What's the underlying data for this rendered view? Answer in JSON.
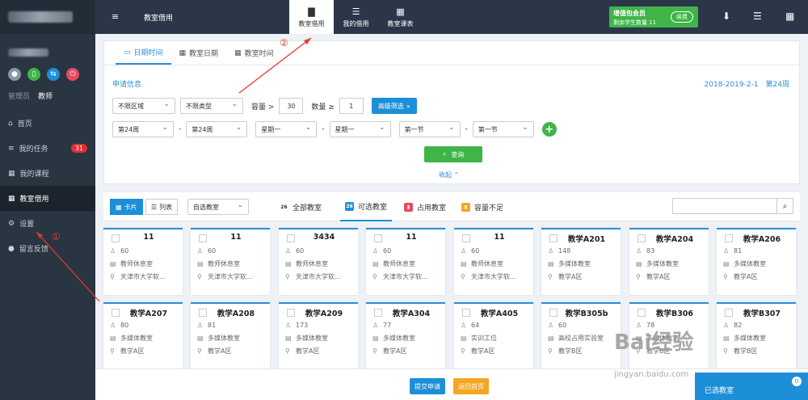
{
  "sidebar": {
    "roles": [
      "管理员",
      "教师"
    ],
    "items": [
      {
        "label": "首页",
        "icon": "home-icon",
        "glyph": "⌂"
      },
      {
        "label": "我的任务",
        "icon": "tasks-icon",
        "glyph": "≡",
        "badge": "31"
      },
      {
        "label": "我的课程",
        "icon": "calendar-icon",
        "glyph": "▦"
      },
      {
        "label": "教室借用",
        "icon": "grid-icon",
        "glyph": "▦",
        "active": true
      },
      {
        "label": "设置",
        "icon": "gear-icon",
        "glyph": "⚙"
      },
      {
        "label": "留言反馈",
        "icon": "chat-icon",
        "glyph": "●"
      }
    ]
  },
  "topbar": {
    "menu_glyph": "≡",
    "title": "教室借用",
    "tabs": [
      {
        "label": "教室借用",
        "icon": "document-icon",
        "glyph": "▇"
      },
      {
        "label": "我的借用",
        "icon": "list-icon",
        "glyph": "☰"
      },
      {
        "label": "教室课表",
        "icon": "calendar-icon",
        "glyph": "▦"
      }
    ],
    "vip_title": "增值包会员",
    "vip_sub": "剩余学生数量 11",
    "renew": "续费",
    "right_icons": [
      {
        "name": "download-icon",
        "glyph": "⬇"
      },
      {
        "name": "server-icon",
        "glyph": "☰"
      },
      {
        "name": "apps-icon",
        "glyph": "▦"
      }
    ]
  },
  "panel": {
    "tabs": [
      {
        "label": "日期时间",
        "icon": "calendar-icon",
        "glyph": "▭"
      },
      {
        "label": "教室日期",
        "icon": "calendar-icon",
        "glyph": "▦"
      },
      {
        "label": "教室时间",
        "icon": "table-icon",
        "glyph": "▦"
      }
    ],
    "section_title": "申请信息",
    "date_info": "2018-2019-2-1　第24周",
    "area": "不限区域",
    "type": "不限类型",
    "capacity_label": "容量 >",
    "capacity_value": "30",
    "qty_label": "数量 ≥",
    "qty_value": "1",
    "advanced": "高级筛选",
    "week_from": "第24周",
    "week_to": "第24周",
    "day_from": "星期一",
    "day_to": "星期一",
    "sec_from": "第一节",
    "sec_to": "第一节",
    "query": "查询",
    "collapse": "收起"
  },
  "filterbar": {
    "view_card": "卡片",
    "view_list": "列表",
    "self_select": "自选教室",
    "tabs": [
      {
        "label": "全部教室",
        "icon_text": "26",
        "color": "#fff",
        "text_color": "#333"
      },
      {
        "label": "可选教室",
        "icon_text": "26",
        "color": "#1c8fd8",
        "text_color": "#fff"
      },
      {
        "label": "占用教室",
        "icon_text": "▮",
        "color": "#e84a5f",
        "text_color": "#fff"
      },
      {
        "label": "容量不足",
        "icon_text": "▮",
        "color": "#f5a623",
        "text_color": "#fff"
      }
    ]
  },
  "rooms": [
    {
      "name": "11",
      "cap": "60",
      "type": "教师休息室",
      "loc": "天津市大学软..."
    },
    {
      "name": "11",
      "cap": "60",
      "type": "教师休息室",
      "loc": "天津市大学软..."
    },
    {
      "name": "3434",
      "cap": "60",
      "type": "教师休息室",
      "loc": "天津市大学软..."
    },
    {
      "name": "11",
      "cap": "60",
      "type": "教师休息室",
      "loc": "天津市大学软..."
    },
    {
      "name": "11",
      "cap": "60",
      "type": "教师休息室",
      "loc": "天津市大学软..."
    },
    {
      "name": "教学A201",
      "cap": "148",
      "type": "多媒体教室",
      "loc": "教学A区"
    },
    {
      "name": "教学A204",
      "cap": "83",
      "type": "多媒体教室",
      "loc": "教学A区"
    },
    {
      "name": "教学A206",
      "cap": "81",
      "type": "多媒体教室",
      "loc": "教学A区"
    },
    {
      "name": "教学A207",
      "cap": "80",
      "type": "多媒体教室",
      "loc": "教学A区"
    },
    {
      "name": "教学A208",
      "cap": "81",
      "type": "多媒体教室",
      "loc": "教学A区"
    },
    {
      "name": "教学A209",
      "cap": "173",
      "type": "多媒体教室",
      "loc": "教学A区"
    },
    {
      "name": "教学A304",
      "cap": "77",
      "type": "多媒体教室",
      "loc": "教学A区"
    },
    {
      "name": "教学A405",
      "cap": "64",
      "type": "实训工位",
      "loc": "教学A区"
    },
    {
      "name": "教学B305b",
      "cap": "60",
      "type": "高校占用实验室",
      "loc": "教学B区"
    },
    {
      "name": "教学B306",
      "cap": "78",
      "type": "多媒体教室",
      "loc": "教学B区"
    },
    {
      "name": "教学B307",
      "cap": "82",
      "type": "多媒体教室",
      "loc": "教学B区"
    }
  ],
  "footer": {
    "submit": "提交申请",
    "back": "返回首页",
    "selected": "已选教室",
    "selected_count": "0"
  },
  "annotations": [
    "①",
    "②"
  ],
  "watermark": {
    "logo": "Bai经验",
    "url": "jingyan.baidu.com"
  }
}
